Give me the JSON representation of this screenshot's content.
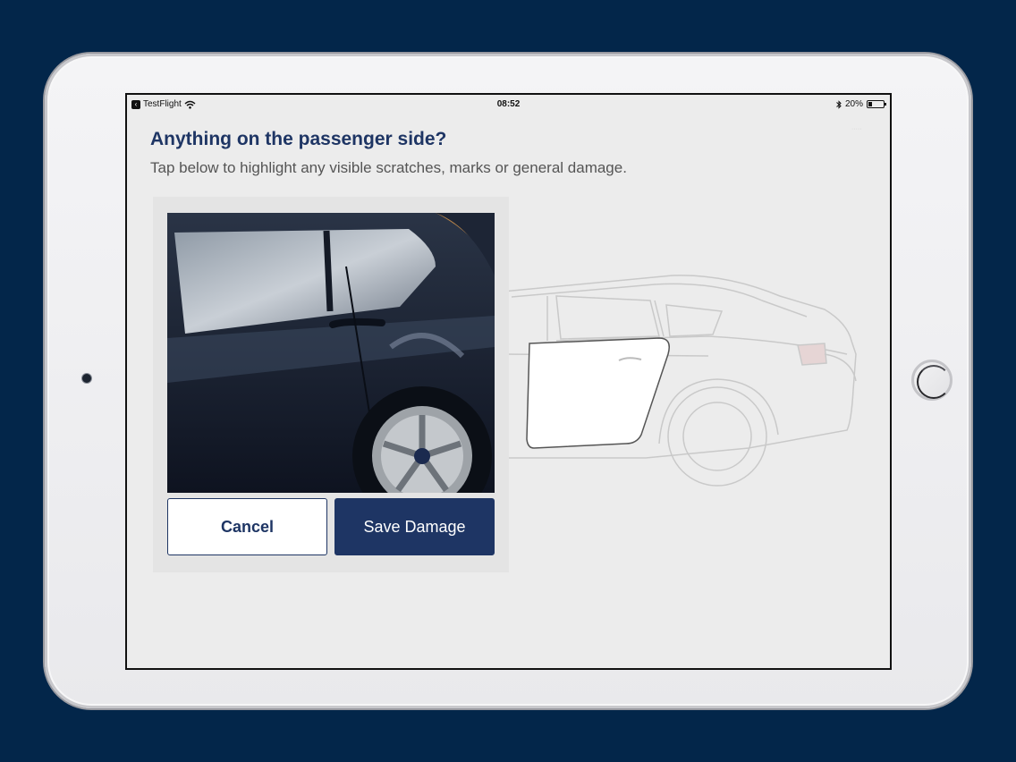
{
  "status_bar": {
    "back_app": "TestFlight",
    "time": "08:52",
    "battery": "20%"
  },
  "page": {
    "title": "Anything on the passenger side?",
    "subtitle": "Tap below to highlight any visible scratches, marks or general damage."
  },
  "damage_card": {
    "cancel_label": "Cancel",
    "save_label": "Save Damage"
  },
  "colors": {
    "brand": "#1e3564",
    "background": "#03264a"
  },
  "icons": [
    "back-arrow-icon",
    "wifi-icon",
    "bluetooth-icon",
    "battery-icon"
  ]
}
